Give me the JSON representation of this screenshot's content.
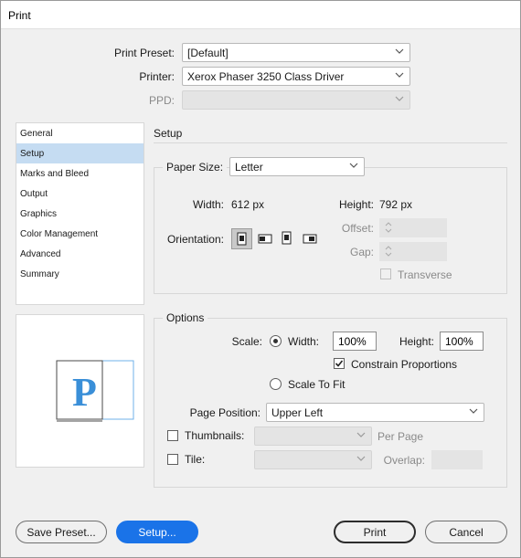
{
  "window": {
    "title": "Print"
  },
  "header": {
    "print_preset_label": "Print Preset:",
    "print_preset_value": "[Default]",
    "printer_label": "Printer:",
    "printer_value": "Xerox Phaser 3250 Class Driver",
    "ppd_label": "PPD:",
    "ppd_value": ""
  },
  "sidebar": {
    "items": [
      {
        "label": "General",
        "selected": false
      },
      {
        "label": "Setup",
        "selected": true
      },
      {
        "label": "Marks and Bleed",
        "selected": false
      },
      {
        "label": "Output",
        "selected": false
      },
      {
        "label": "Graphics",
        "selected": false
      },
      {
        "label": "Color Management",
        "selected": false
      },
      {
        "label": "Advanced",
        "selected": false
      },
      {
        "label": "Summary",
        "selected": false
      }
    ]
  },
  "preview": {
    "letter": "P"
  },
  "setup": {
    "title": "Setup",
    "paper_size_label": "Paper Size:",
    "paper_size_value": "Letter",
    "width_label": "Width:",
    "width_value": "612 px",
    "height_label": "Height:",
    "height_value": "792 px",
    "orientation_label": "Orientation:",
    "orientation_icons": [
      "portrait-icon",
      "landscape-icon",
      "reverse-portrait-icon",
      "reverse-landscape-icon"
    ],
    "offset_label": "Offset:",
    "offset_value": "",
    "gap_label": "Gap:",
    "gap_value": "",
    "transverse_label": "Transverse",
    "transverse_checked": false
  },
  "options": {
    "title": "Options",
    "scale_label": "Scale:",
    "width_radio_label": "Width:",
    "scale_width_value": "100%",
    "scale_height_label": "Height:",
    "scale_height_value": "100%",
    "constrain_label": "Constrain Proportions",
    "constrain_checked": true,
    "scale_to_fit_label": "Scale To Fit",
    "page_position_label": "Page Position:",
    "page_position_value": "Upper Left",
    "thumbnails_label": "Thumbnails:",
    "thumbnails_value": "",
    "per_page_label": "Per Page",
    "tile_label": "Tile:",
    "tile_value": "",
    "overlap_label": "Overlap:",
    "overlap_value": ""
  },
  "footer": {
    "save_preset_label": "Save Preset...",
    "setup_button_label": "Setup...",
    "print_label": "Print",
    "cancel_label": "Cancel"
  },
  "colors": {
    "accent": "#1a73e8",
    "selection": "#c5dcf2",
    "preview_blue": "#3a8fd8"
  }
}
